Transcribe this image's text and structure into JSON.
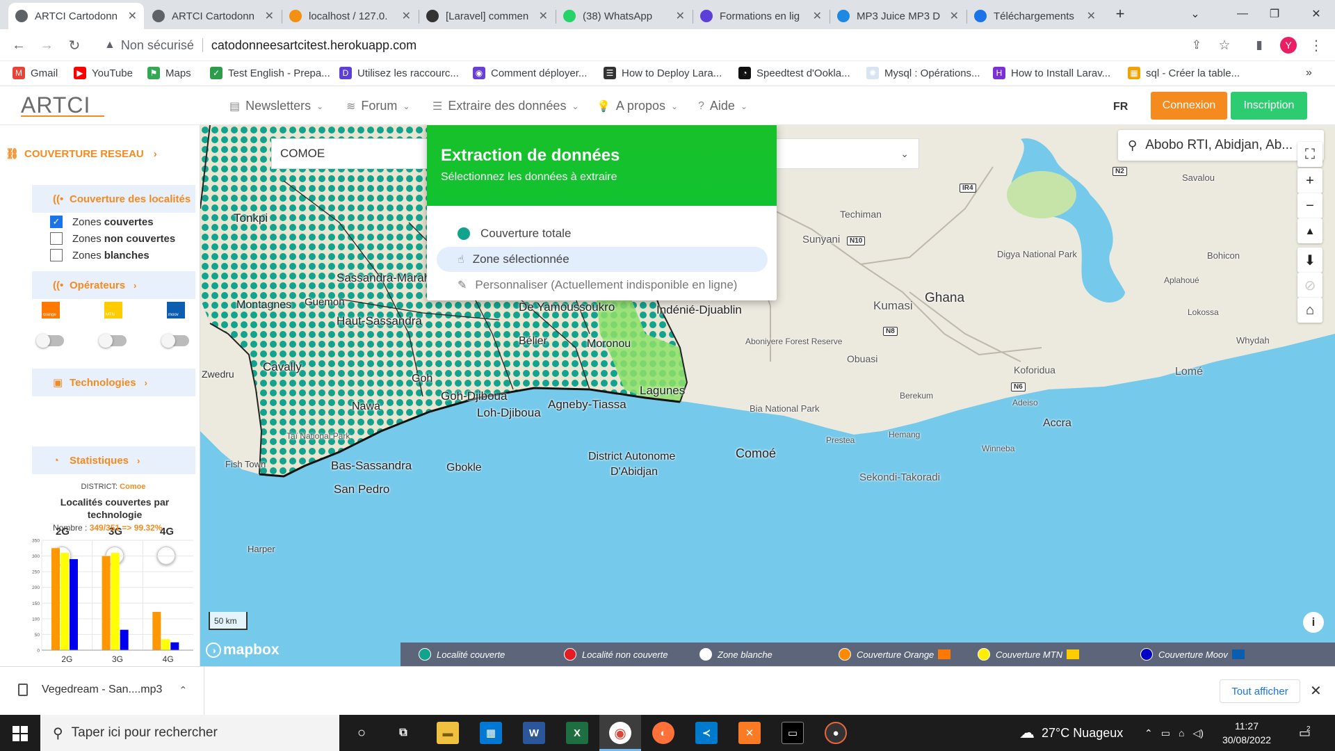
{
  "browser": {
    "tabs": [
      {
        "title": "ARTCI Cartodonn",
        "active": true,
        "icon_color": "#5f6368"
      },
      {
        "title": "ARTCI Cartodonn",
        "active": false,
        "icon_color": "#5f6368"
      },
      {
        "title": "localhost / 127.0.",
        "active": false,
        "icon_color": "#f29111"
      },
      {
        "title": "[Laravel] commen",
        "active": false,
        "icon_color": "#333333"
      },
      {
        "title": "(38) WhatsApp",
        "active": false,
        "icon_color": "#25d366"
      },
      {
        "title": "Formations en lig",
        "active": false,
        "icon_color": "#5c3fd6"
      },
      {
        "title": "MP3 Juice MP3 D",
        "active": false,
        "icon_color": "#1e88e5"
      },
      {
        "title": "Téléchargements",
        "active": false,
        "icon_color": "#1a73e8"
      }
    ],
    "security_label": "Non sécurisé",
    "url": "catodonneesartcitest.herokuapp.com",
    "profile_initial": "Y",
    "bookmarks": [
      {
        "label": "Gmail",
        "color": "#ea4335",
        "glyph": "M"
      },
      {
        "label": "YouTube",
        "color": "#ff0000",
        "glyph": "▶"
      },
      {
        "label": "Maps",
        "color": "#34a853",
        "glyph": "⚑"
      },
      {
        "label": "Test English - Prepa...",
        "color": "#2e9d4b",
        "glyph": "✓"
      },
      {
        "label": "Utilisez les raccourc...",
        "color": "#5c3fd6",
        "glyph": "D"
      },
      {
        "label": "Comment déployer...",
        "color": "#6a3fd6",
        "glyph": "◉"
      },
      {
        "label": "How to Deploy Lara...",
        "color": "#333333",
        "glyph": "☰"
      },
      {
        "label": "Speedtest d'Ookla...",
        "color": "#111111",
        "glyph": "◔"
      },
      {
        "label": "Mysql : Opérations...",
        "color": "#d8e4f0",
        "glyph": "✺"
      },
      {
        "label": "How to Install Larav...",
        "color": "#7b2fd6",
        "glyph": "H"
      },
      {
        "label": "sql - Créer la table...",
        "color": "#f2a100",
        "glyph": "▦"
      }
    ]
  },
  "app": {
    "logo_text": "ARTCI",
    "nav": [
      {
        "label": "Newsletters",
        "icon": "newspaper-icon",
        "glyph": "▤"
      },
      {
        "label": "Forum",
        "icon": "forum-icon",
        "glyph": "≋"
      },
      {
        "label": "Extraire des données",
        "icon": "database-icon",
        "glyph": "☰"
      },
      {
        "label": "A propos",
        "icon": "bulb-icon",
        "glyph": "💡"
      },
      {
        "label": "Aide",
        "icon": "help-icon",
        "glyph": "?"
      }
    ],
    "lang": "FR",
    "login_label": "Connexion",
    "signup_label": "Inscription",
    "colors": {
      "orange": "#f58a1f",
      "green": "#2ecc71",
      "teal": "#12a38f"
    }
  },
  "sidebar": {
    "title": "COUVERTURE RESEAU",
    "localites_title": "Couverture des localités",
    "zones": [
      {
        "prefix": "Zones",
        "bold": "couvertes",
        "checked": true
      },
      {
        "prefix": "Zones",
        "bold": "non couvertes",
        "checked": false
      },
      {
        "prefix": "Zones",
        "bold": "blanches",
        "checked": false
      }
    ],
    "operators_title": "Opérateurs",
    "operators": [
      {
        "name": "orange",
        "color": "#ff7900"
      },
      {
        "name": "MTN",
        "color": "#ffcc00"
      },
      {
        "name": "moov",
        "color": "#0b5db0"
      }
    ],
    "technologies_title": "Technologies",
    "technologies": [
      "2G",
      "3G",
      "4G"
    ],
    "stats_title": "Statistiques",
    "district_label": "DISTRICT:",
    "district_value": "Comoe",
    "chart_title": "Localités couvertes par technologie",
    "count_label": "Nombre :",
    "count_value": "349/351 => 99.32%"
  },
  "chart_data": {
    "type": "bar",
    "categories": [
      "2G",
      "3G",
      "4G"
    ],
    "series": [
      {
        "name": "Orange",
        "color": "#ff9800",
        "values": [
          325,
          300,
          122
        ]
      },
      {
        "name": "MTN",
        "color": "#ffff00",
        "values": [
          310,
          310,
          35
        ]
      },
      {
        "name": "Moov",
        "color": "#0000ee",
        "values": [
          290,
          65,
          25
        ]
      }
    ],
    "yticks": [
      0,
      50,
      100,
      150,
      200,
      250,
      300,
      350
    ],
    "ylim": [
      0,
      350
    ],
    "grid": true
  },
  "map": {
    "district_select": "COMOE",
    "search_value": "Abobo RTI, Abidjan, Ab...",
    "modal": {
      "title": "Extraction de données",
      "subtitle": "Sélectionnez les données à extraire",
      "options": [
        {
          "label": "Couverture totale",
          "icon": "dot",
          "hover": false,
          "disabled": false
        },
        {
          "label": "Zone sélectionnée",
          "icon": "pointer-icon",
          "hover": true,
          "disabled": false
        },
        {
          "label": "Personnaliser (Actuellement indisponible en ligne)",
          "icon": "edit-icon",
          "hover": false,
          "disabled": true
        }
      ]
    },
    "labels": [
      {
        "text": "Tonkpi"
      },
      {
        "text": "Sassandra-Marahoué"
      },
      {
        "text": "Montagnes"
      },
      {
        "text": "Guemon"
      },
      {
        "text": "Haut-Sassandra"
      },
      {
        "text": "Cavally"
      },
      {
        "text": "Zwedru"
      },
      {
        "text": "Nawa"
      },
      {
        "text": "Goh"
      },
      {
        "text": "Goh-Djiboua"
      },
      {
        "text": "Loh-Djiboua"
      },
      {
        "text": "Bélier"
      },
      {
        "text": "Moronou"
      },
      {
        "text": "Lagunes"
      },
      {
        "text": "Agneby-Tiassa"
      },
      {
        "text": "De Yamoussoukro"
      },
      {
        "text": "Indénié-Djuablin"
      },
      {
        "text": "Bas-Sassandra"
      },
      {
        "text": "Gbokle"
      },
      {
        "text": "San Pedro"
      },
      {
        "text": "District Autonome"
      },
      {
        "text": "D'Abidjan"
      },
      {
        "text": "Comoé"
      },
      {
        "text": "Fish Town"
      },
      {
        "text": "Harper"
      },
      {
        "text": "Techiman"
      },
      {
        "text": "Sunyani"
      },
      {
        "text": "Ghana"
      },
      {
        "text": "Kumasi"
      },
      {
        "text": "Obuasi"
      },
      {
        "text": "Koforidua"
      },
      {
        "text": "Accra"
      },
      {
        "text": "Sekondi-Takoradi"
      },
      {
        "text": "Digya National Park"
      },
      {
        "text": "Savalou"
      },
      {
        "text": "Bohicon"
      },
      {
        "text": "Lomé"
      },
      {
        "text": "Lokossa"
      },
      {
        "text": "Aplahoué"
      },
      {
        "text": "Whydah"
      },
      {
        "text": "Prestea"
      },
      {
        "text": "Hemang"
      },
      {
        "text": "Winneba"
      },
      {
        "text": "Adeiso"
      },
      {
        "text": "Berekum"
      },
      {
        "text": "Aboniyere Forest Reserve"
      },
      {
        "text": "Bia National Park"
      },
      {
        "text": "Taï National Park"
      }
    ],
    "road_shields": [
      "IR4",
      "N2",
      "N10",
      "N8",
      "N6"
    ],
    "scale_label": "50 km",
    "attribution": "mapbox",
    "legend": [
      {
        "label": "Localité couverte",
        "color": "#12a38f",
        "tag": null
      },
      {
        "label": "Localité non couverte",
        "color": "#e51c23",
        "tag": null
      },
      {
        "label": "Zone blanche",
        "color": "#ffffff",
        "tag": null
      },
      {
        "label": "Couverture Orange",
        "color": "#ff8a00",
        "tag": "#ff7900"
      },
      {
        "label": "Couverture MTN",
        "color": "#ffee00",
        "tag": "#ffcc00"
      },
      {
        "label": "Couverture Moov",
        "color": "#0000c8",
        "tag": "#0b5db0"
      }
    ]
  },
  "downloads": {
    "file": "Vegedream - San....mp3",
    "show_all": "Tout afficher"
  },
  "taskbar": {
    "search_placeholder": "Taper ici pour rechercher",
    "weather": "27°C  Nuageux",
    "time": "11:27",
    "date": "30/08/2022",
    "notif_count": "2"
  }
}
